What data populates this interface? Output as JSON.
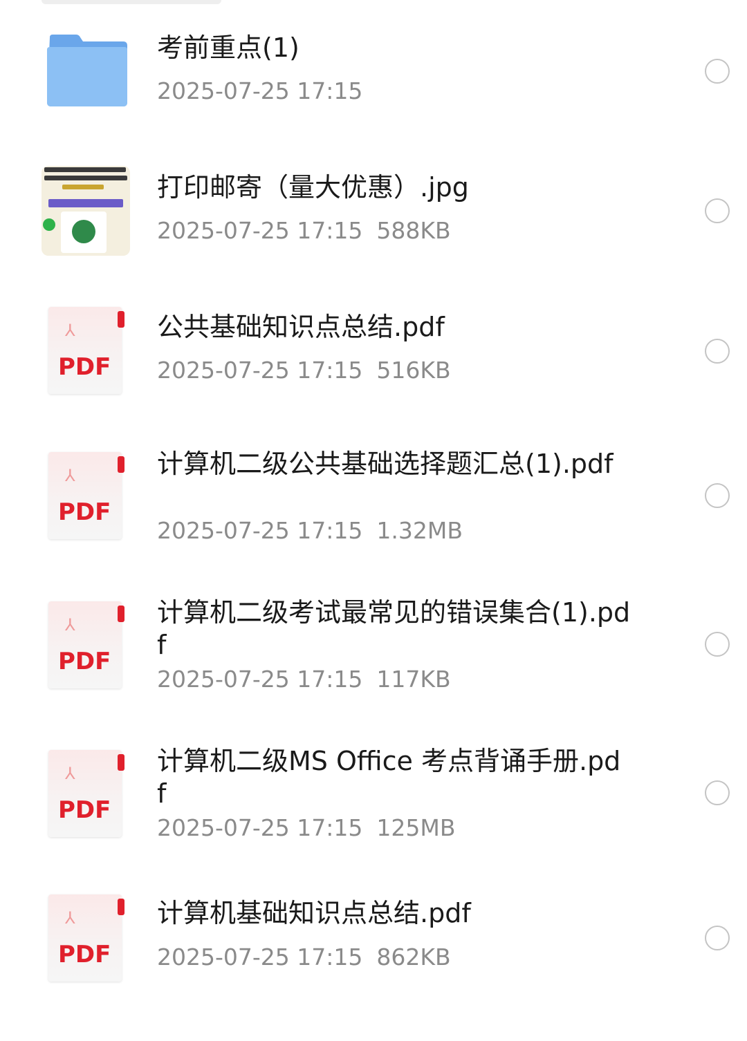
{
  "files": [
    {
      "type": "folder",
      "icon": "folder-icon",
      "name": "考前重点(1)",
      "date": "2025-07-25 17:15",
      "size": ""
    },
    {
      "type": "image",
      "icon": "image-thumbnail",
      "name": "打印邮寄（量大优惠）.jpg",
      "date": "2025-07-25 17:15",
      "size": "588KB"
    },
    {
      "type": "pdf",
      "icon": "pdf-icon",
      "icon_label": "PDF",
      "name": "公共基础知识点总结.pdf",
      "date": "2025-07-25 17:15",
      "size": "516KB"
    },
    {
      "type": "pdf",
      "icon": "pdf-icon",
      "icon_label": "PDF",
      "name": "计算机二级公共基础选择题汇总(1).pdf",
      "date": "2025-07-25 17:15",
      "size": "1.32MB"
    },
    {
      "type": "pdf",
      "icon": "pdf-icon",
      "icon_label": "PDF",
      "name": "计算机二级考试最常见的错误集合(1).pdf",
      "date": "2025-07-25 17:15",
      "size": "117KB"
    },
    {
      "type": "pdf",
      "icon": "pdf-icon",
      "icon_label": "PDF",
      "name": "计算机二级MS Office 考点背诵手册.pdf",
      "date": "2025-07-25 17:15",
      "size": "125MB"
    },
    {
      "type": "pdf",
      "icon": "pdf-icon",
      "icon_label": "PDF",
      "name": "计算机基础知识点总结.pdf",
      "date": "2025-07-25 17:15",
      "size": "862KB"
    }
  ],
  "colors": {
    "folder": "#7fb5f0",
    "pdf_red": "#e0202c",
    "meta_gray": "#8a8a8a",
    "name_text": "#1a1a1a",
    "radio_border": "#c4c4c4"
  }
}
